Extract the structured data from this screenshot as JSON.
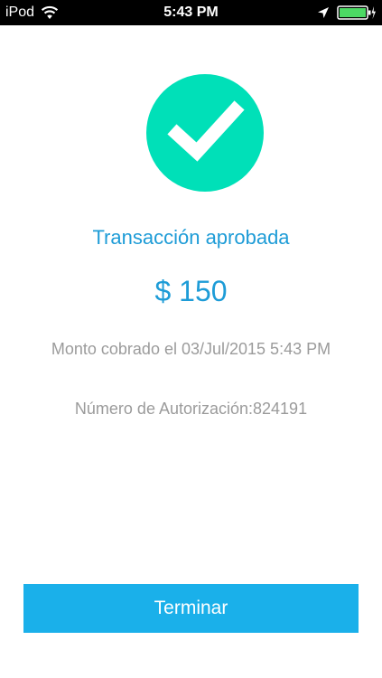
{
  "status_bar": {
    "carrier": "iPod",
    "time": "5:43 PM",
    "icons": [
      "wifi-icon",
      "location-arrow-icon",
      "battery-charging-icon"
    ]
  },
  "result": {
    "icon": "checkmark-icon",
    "icon_color": "#00e0b8",
    "title": "Transacción aprobada",
    "amount": "$ 150",
    "charged_label": "Monto cobrado el",
    "charged_date": "03/Jul/2015 5:43 PM",
    "auth_text": "Número de Autorización:824191"
  },
  "actions": {
    "finish_label": "Terminar",
    "finish_color": "#1ab0ea"
  },
  "colors": {
    "accent_text": "#1e9cd7",
    "secondary_text": "#9b9b9b"
  }
}
